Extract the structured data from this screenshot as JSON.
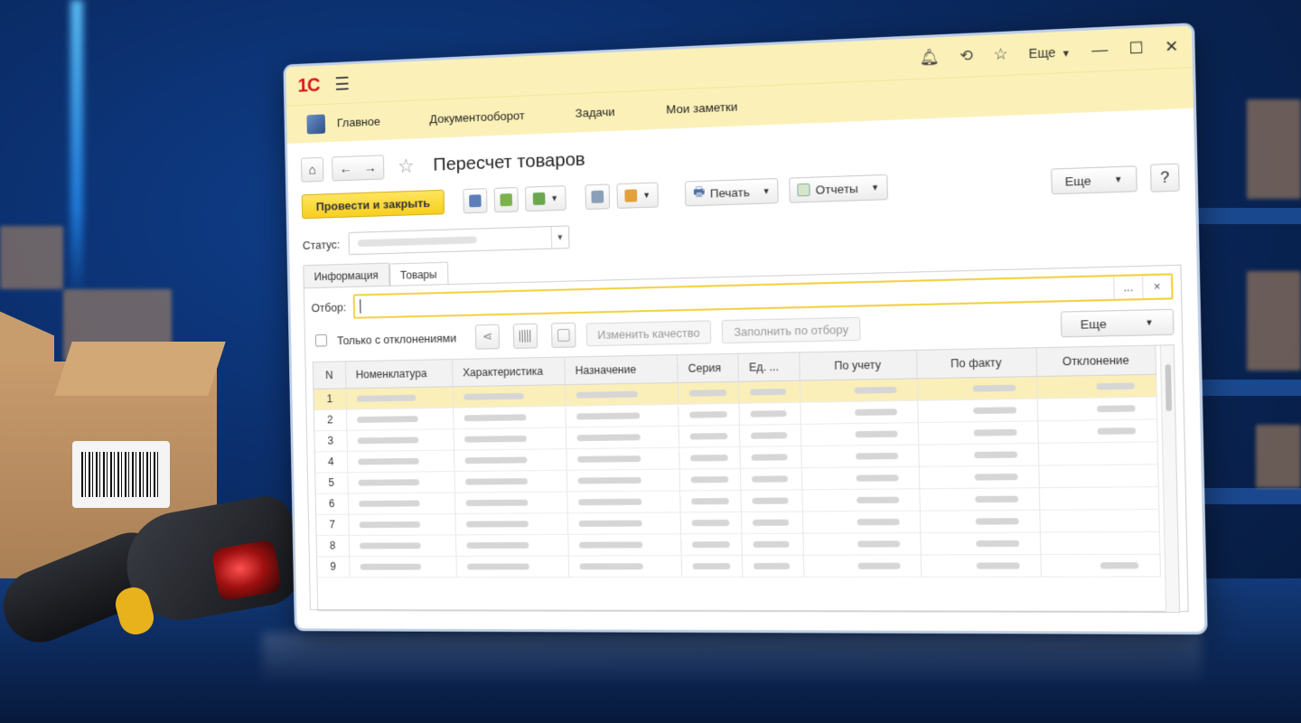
{
  "window": {
    "logo_text": "1С",
    "more_label": "Еще"
  },
  "menu": {
    "items": [
      "Главное",
      "Документооборот",
      "Задачи",
      "Мои заметки"
    ]
  },
  "document": {
    "title": "Пересчет товаров",
    "post_close_label": "Провести и закрыть",
    "print_label": "Печать",
    "reports_label": "Отчеты",
    "more_label": "Еще",
    "help_label": "?",
    "status_label": "Статус:"
  },
  "tabs": [
    "Информация",
    "Товары"
  ],
  "active_tab": "Товары",
  "goods": {
    "filter_label": "Отбор:",
    "filter_ellipsis": "...",
    "filter_clear": "×",
    "deviations_only_label": "Только с отклонениями",
    "change_quality_label": "Изменить качество",
    "fill_by_filter_label": "Заполнить по отбору",
    "more_label": "Еще",
    "columns": [
      "N",
      "Номенклатура",
      "Характеристика",
      "Назначение",
      "Серия",
      "Ед. ...",
      "По учету",
      "По факту",
      "Отклонение"
    ],
    "rows": [
      {
        "n": "1"
      },
      {
        "n": "2"
      },
      {
        "n": "3"
      },
      {
        "n": "4"
      },
      {
        "n": "5"
      },
      {
        "n": "6"
      },
      {
        "n": "7"
      },
      {
        "n": "8"
      },
      {
        "n": "9"
      }
    ]
  },
  "colors": {
    "header_yellow": "#fbf1b8",
    "primary_button": "#f7cf1f",
    "selected_row": "#fbefb9",
    "logo_red": "#d8141c"
  }
}
